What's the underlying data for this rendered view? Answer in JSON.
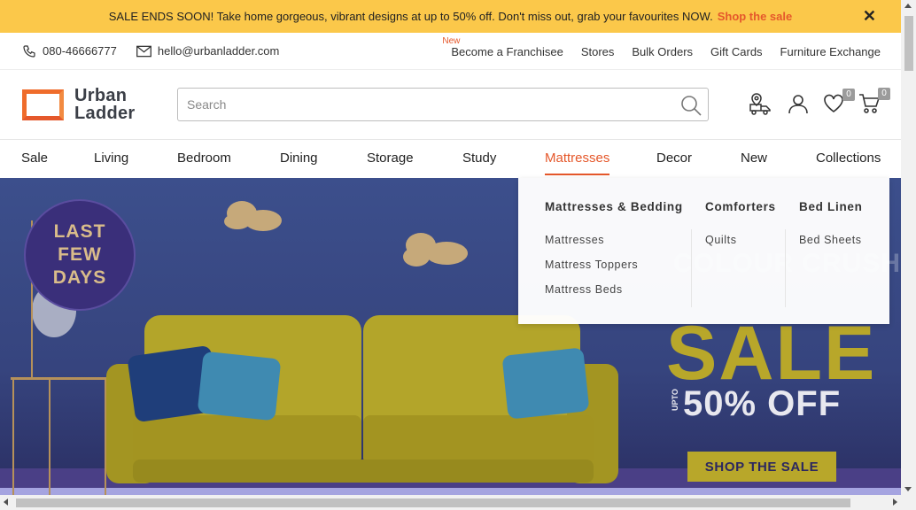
{
  "promo": {
    "message": "SALE ENDS SOON! Take home gorgeous, vibrant designs at up to 50% off. Don't miss out, grab your favourites NOW.",
    "link": "Shop the sale",
    "close": "✕",
    "link_color": "#e5582b",
    "bg_color": "#fbc84a"
  },
  "utility": {
    "phone": "080-46666777",
    "email": "hello@urbanladder.com",
    "links": [
      {
        "label": "Become a Franchisee",
        "tag": "New"
      },
      {
        "label": "Stores"
      },
      {
        "label": "Bulk Orders"
      },
      {
        "label": "Gift Cards"
      },
      {
        "label": "Furniture Exchange"
      }
    ]
  },
  "header": {
    "logo_line1": "Urban",
    "logo_line2": "Ladder",
    "search_placeholder": "Search",
    "wishlist_count": "0",
    "cart_count": "0",
    "icons": [
      "track-order-icon",
      "profile-icon",
      "wishlist-icon",
      "cart-icon"
    ]
  },
  "nav": {
    "items": [
      "Sale",
      "Living",
      "Bedroom",
      "Dining",
      "Storage",
      "Study",
      "Mattresses",
      "Decor",
      "New",
      "Collections"
    ],
    "active": "Mattresses",
    "accent": "#e5582b"
  },
  "dropdown": {
    "columns": [
      {
        "heading": "Mattresses & Bedding",
        "links": [
          "Mattresses",
          "Mattress Toppers",
          "Mattress Beds"
        ]
      },
      {
        "heading": "Comforters",
        "links": [
          "Quilts"
        ]
      },
      {
        "heading": "Bed Linen",
        "links": [
          "Bed Sheets"
        ]
      }
    ]
  },
  "hero": {
    "badge_line1": "LAST",
    "badge_line2": "FEW",
    "badge_line3": "DAYS",
    "sale": "SALE",
    "upto": "UPTO",
    "discount": "50% OFF",
    "cta": "SHOP THE SALE"
  }
}
